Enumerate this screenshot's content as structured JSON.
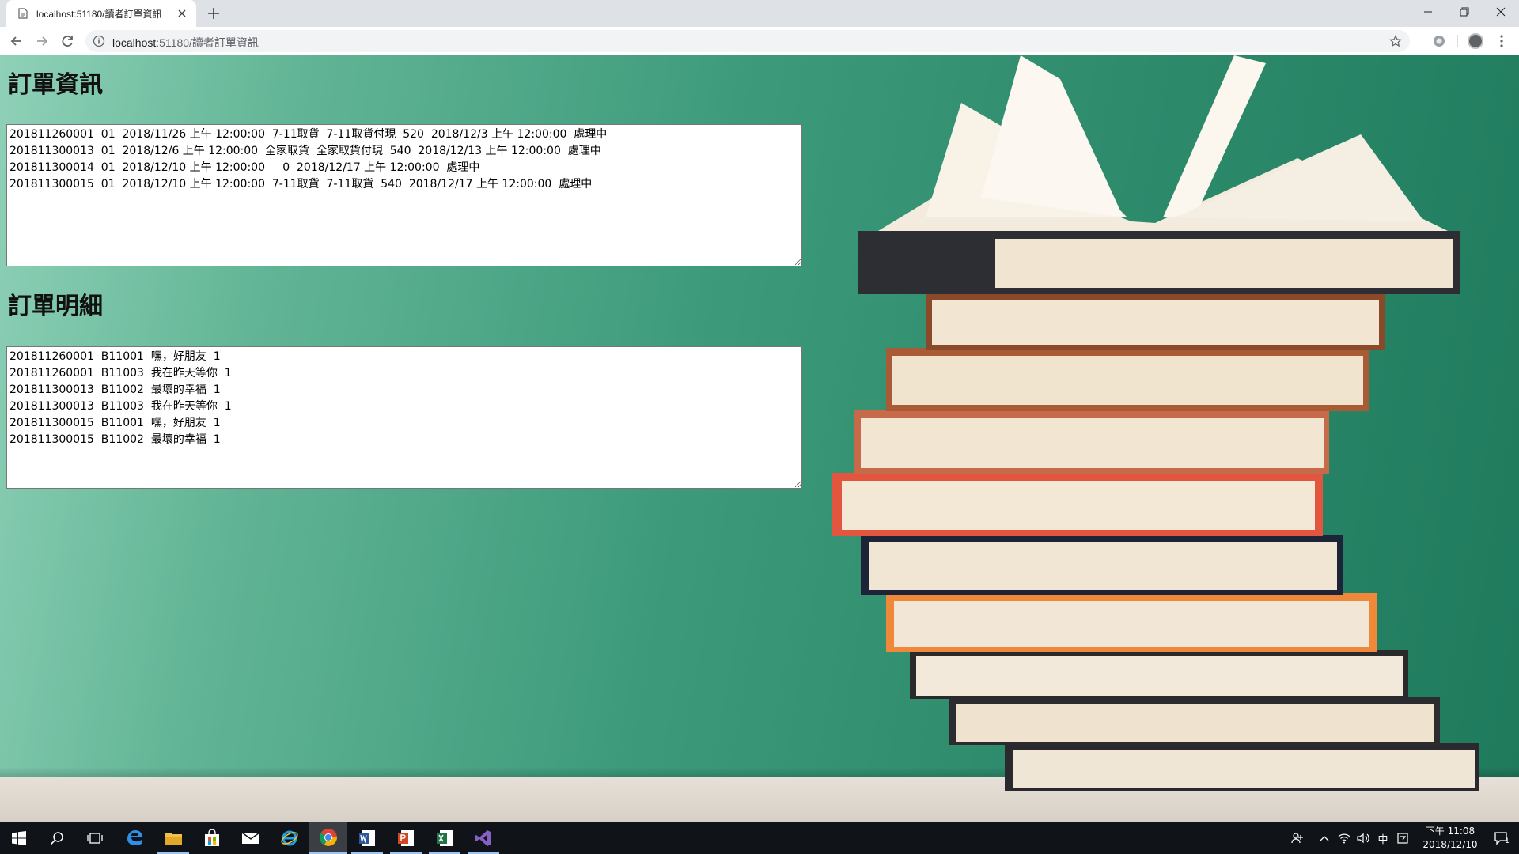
{
  "browser": {
    "tab_title": "localhost:51180/讀者訂單資訊",
    "url_host": "localhost",
    "url_path": ":51180/讀者訂單資訊"
  },
  "page": {
    "orders_heading": "訂單資訊",
    "orders_text": "201811260001  01  2018/11/26 上午 12:00:00  7-11取貨  7-11取貨付現  520  2018/12/3 上午 12:00:00  處理中\n201811300013  01  2018/12/6 上午 12:00:00  全家取貨  全家取貨付現  540  2018/12/13 上午 12:00:00  處理中\n201811300014  01  2018/12/10 上午 12:00:00     0  2018/12/17 上午 12:00:00  處理中\n201811300015  01  2018/12/10 上午 12:00:00  7-11取貨  7-11取貨  540  2018/12/17 上午 12:00:00  處理中",
    "details_heading": "訂單明細",
    "details_text": "201811260001  B11001  嘿，好朋友  1\n201811260001  B11003  我在昨天等你  1\n201811300013  B11002  最壞的幸福  1\n201811300013  B11003  我在昨天等你  1\n201811300015  B11001  嘿，好朋友  1\n201811300015  B11002  最壞的幸福  1"
  },
  "taskbar": {
    "apps": [
      "start-icon",
      "search-icon",
      "task-view-icon",
      "edge-icon",
      "file-explorer-icon",
      "store-icon",
      "mail-icon",
      "ie-icon",
      "chrome-icon",
      "word-icon",
      "powerpoint-icon",
      "excel-icon",
      "visual-studio-icon"
    ],
    "ime": "中",
    "time": "下午 11:08",
    "date": "2018/12/10",
    "notification_count": "1"
  },
  "colors": {
    "chalkboard": "#2d8b6c",
    "taskbar": "#101418",
    "chrome_tabstrip": "#dee1e6"
  }
}
